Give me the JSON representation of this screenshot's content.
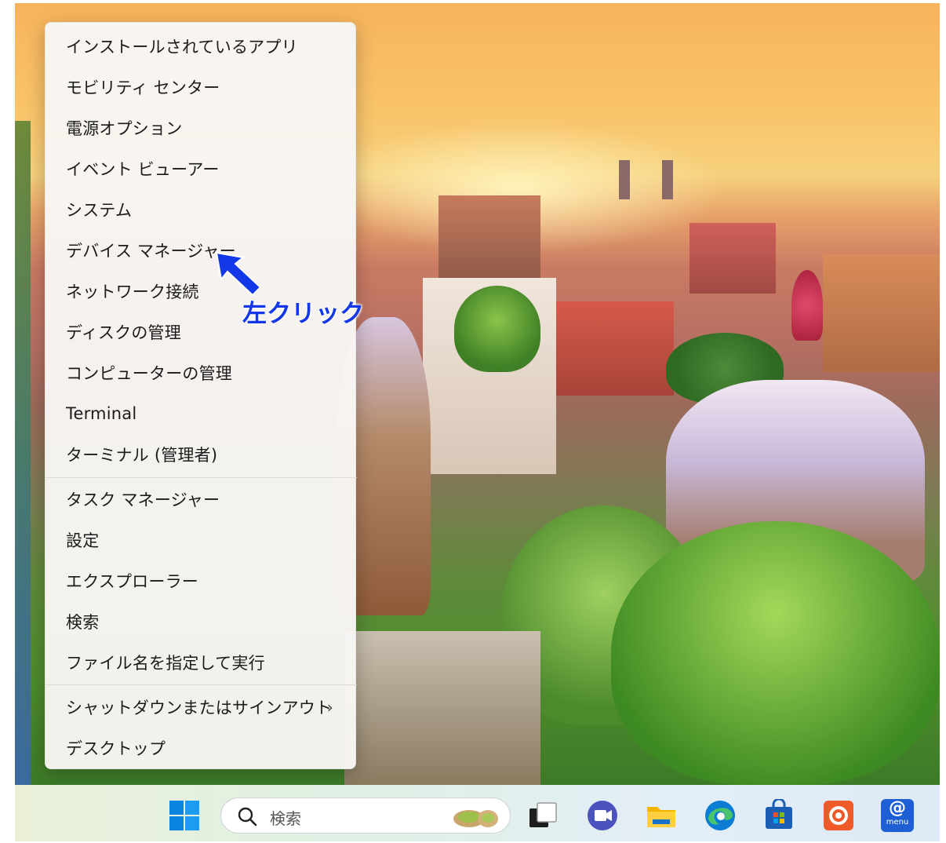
{
  "menu": {
    "items": [
      {
        "label": "インストールされているアプリ"
      },
      {
        "label": "モビリティ センター"
      },
      {
        "label": "電源オプション"
      },
      {
        "label": "イベント ビューアー"
      },
      {
        "label": "システム"
      },
      {
        "label": "デバイス マネージャー"
      },
      {
        "label": "ネットワーク接続"
      },
      {
        "label": "ディスクの管理"
      },
      {
        "label": "コンピューターの管理"
      },
      {
        "label": "Terminal"
      },
      {
        "label": "ターミナル (管理者)"
      },
      {
        "label": "タスク マネージャー"
      },
      {
        "label": "設定"
      },
      {
        "label": "エクスプローラー"
      },
      {
        "label": "検索"
      },
      {
        "label": "ファイル名を指定して実行"
      },
      {
        "label": "シャットダウンまたはサインアウト",
        "chevron": "›"
      },
      {
        "label": "デスクトップ"
      }
    ]
  },
  "annotation": {
    "text": "左クリック",
    "color": "#1438e8"
  },
  "taskbar": {
    "search_placeholder": "検索",
    "icons": [
      "windows-start-icon",
      "search-icon",
      "task-view-icon",
      "meet-icon",
      "file-explorer-icon",
      "edge-icon",
      "microsoft-store-icon",
      "app-icon",
      "menu-app-icon"
    ],
    "menu_app_label": "menu",
    "at_symbol": "@"
  },
  "colors": {
    "accent_blue": "#0078d4",
    "annotation_blue": "#1438e8"
  }
}
